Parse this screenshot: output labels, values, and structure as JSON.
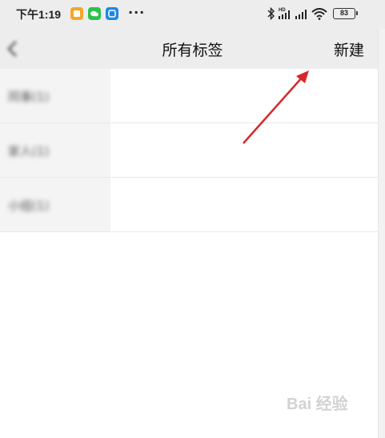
{
  "status_bar": {
    "time": "下午1:19",
    "more": "···",
    "signal_label": "HD",
    "battery": "83"
  },
  "nav": {
    "title": "所有标签",
    "new_label": "新建"
  },
  "tags": [
    {
      "label": "同事(1)"
    },
    {
      "label": "家人(1)"
    },
    {
      "label": "小组(1)"
    }
  ],
  "watermark": "Bai 经验",
  "colors": {
    "nav_bg": "#ededed",
    "arrow": "#d9262b"
  }
}
